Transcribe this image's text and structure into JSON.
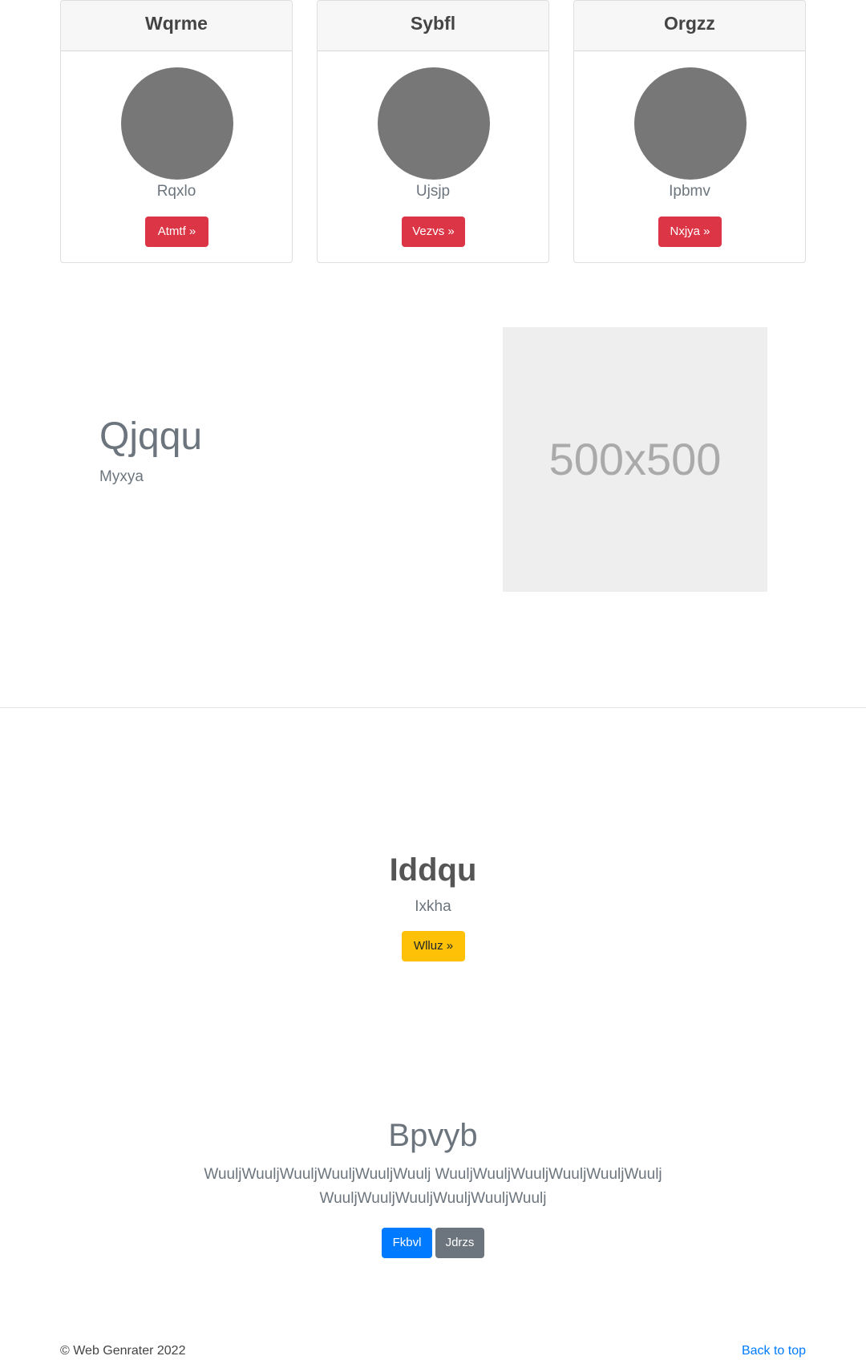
{
  "cards": [
    {
      "title": "Wqrme",
      "subtitle": "Rqxlo",
      "button_label": "Atmtf »"
    },
    {
      "title": "Sybfl",
      "subtitle": "Ujsjp",
      "button_label": "Vezvs »"
    },
    {
      "title": "Orgzz",
      "subtitle": "Ipbmv",
      "button_label": "Nxjya »"
    }
  ],
  "feature": {
    "title": "Qjqqu",
    "subtitle": "Myxya",
    "image_text": "500x500"
  },
  "cta": {
    "title": "Iddqu",
    "subtitle": "Ixkha",
    "button_label": "Wlluz »"
  },
  "bottom": {
    "title": "Bpvyb",
    "text": "WuuljWuuljWuuljWuuljWuuljWuulj WuuljWuuljWuuljWuuljWuuljWuulj WuuljWuuljWuuljWuuljWuuljWuulj",
    "primary_label": "Fkbvl",
    "secondary_label": "Jdrzs"
  },
  "footer": {
    "copyright": "© Web Genrater 2022",
    "back_to_top": "Back to top"
  },
  "colors": {
    "danger": "#dc3545",
    "warning": "#ffc107",
    "primary": "#007bff",
    "secondary": "#6c757d",
    "avatar": "#777777",
    "placeholder_bg": "#eeeeee"
  }
}
